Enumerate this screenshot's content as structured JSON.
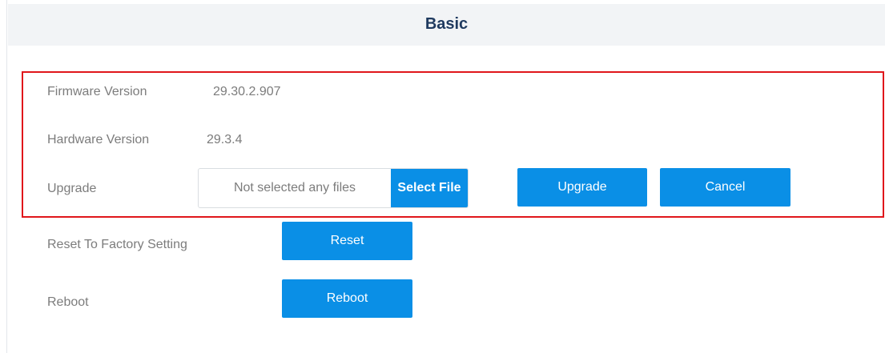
{
  "header": {
    "title": "Basic"
  },
  "firmware": {
    "label": "Firmware Version",
    "value": "29.30.2.907"
  },
  "hardware": {
    "label": "Hardware Version",
    "value": "29.3.4"
  },
  "upgrade": {
    "label": "Upgrade",
    "file_placeholder": "Not selected any files",
    "select_file_label": "Select File",
    "upgrade_button": "Upgrade",
    "cancel_button": "Cancel"
  },
  "reset": {
    "label": "Reset To Factory Setting",
    "button": "Reset"
  },
  "reboot": {
    "label": "Reboot",
    "button": "Reboot"
  },
  "colors": {
    "accent": "#0a8fe6",
    "highlight": "#e0161b",
    "title": "#1f3a5f"
  }
}
